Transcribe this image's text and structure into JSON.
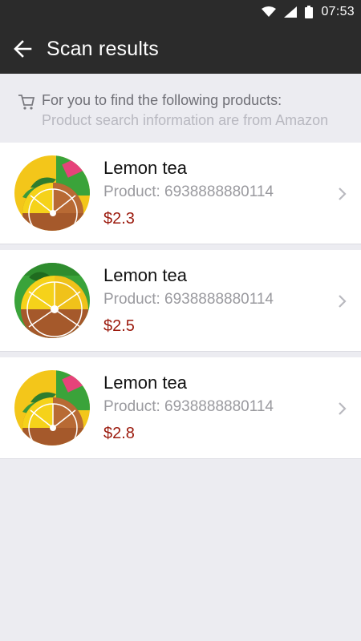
{
  "status_bar": {
    "time": "07:53"
  },
  "app_bar": {
    "title": "Scan results"
  },
  "info": {
    "line1": "For you to find the following products:",
    "line2": "Product search information are from Amazon"
  },
  "results": [
    {
      "name": "Lemon tea",
      "code": "Product: 6938888880114",
      "price": "$2.3"
    },
    {
      "name": "Lemon tea",
      "code": "Product: 6938888880114",
      "price": "$2.5"
    },
    {
      "name": "Lemon tea",
      "code": "Product: 6938888880114",
      "price": "$2.8"
    }
  ],
  "colors": {
    "app_bar": "#2b2b2b",
    "background": "#ececf1",
    "price": "#9b1a0d"
  }
}
